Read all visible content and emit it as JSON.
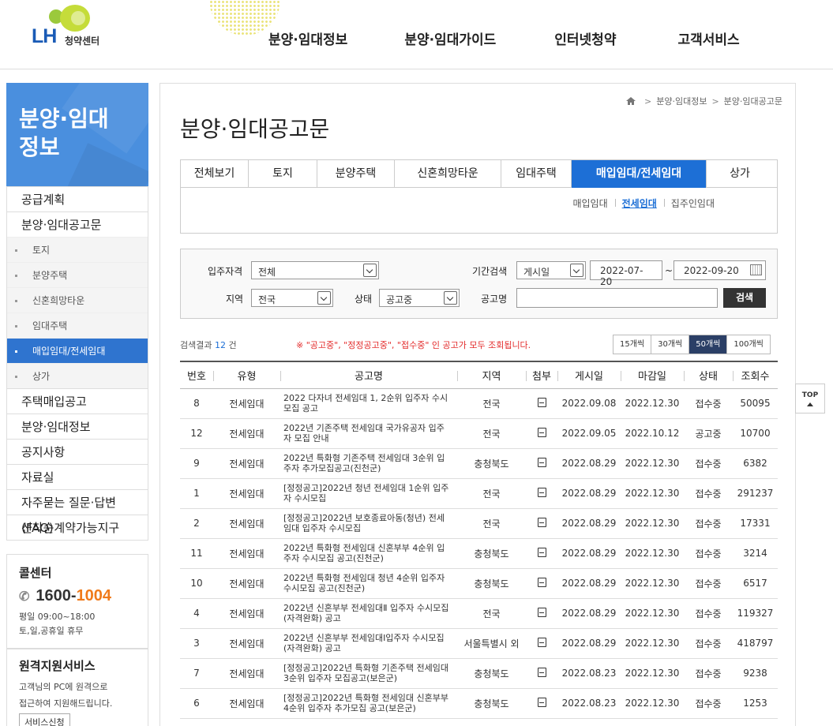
{
  "header": {
    "logo_text": "LH",
    "logo_sub": "청약센터",
    "nav": [
      "분양·임대정보",
      "분양·임대가이드",
      "인터넷청약",
      "고객서비스"
    ]
  },
  "sidebar": {
    "title": "분양·임대 정보",
    "menu": [
      {
        "label": "공급계획",
        "level": 1
      },
      {
        "label": "분양·임대공고문",
        "level": 1
      },
      {
        "label": "토지",
        "level": 2
      },
      {
        "label": "분양주택",
        "level": 2
      },
      {
        "label": "신혼희망타운",
        "level": 2
      },
      {
        "label": "임대주택",
        "level": 2
      },
      {
        "label": "매입임대/전세임대",
        "level": 2,
        "active": true
      },
      {
        "label": "상가",
        "level": 2
      },
      {
        "label": "주택매입공고",
        "level": 1
      },
      {
        "label": "분양·임대정보",
        "level": 1
      },
      {
        "label": "공지사항",
        "level": 1
      },
      {
        "label": "자료실",
        "level": 1
      },
      {
        "label": "자주묻는 질문·답변(FAQ)",
        "level": 1
      },
      {
        "label": "선착순계약가능지구",
        "level": 1
      }
    ],
    "callcenter": {
      "title": "콜센터",
      "num_a": "1600-",
      "num_b": "1004",
      "hours": "평일 09:00~18:00",
      "holiday": "토,일,공휴일 휴무"
    },
    "remote": {
      "title": "원격지원서비스",
      "line1": "고객님의 PC에 원격으로",
      "line2": "접근하여 지원해드립니다.",
      "button": "서비스신청"
    }
  },
  "breadcrumb": [
    "분양·임대정보",
    "분양·임대공고문"
  ],
  "page_title": "분양·임대공고문",
  "tabs": [
    "전체보기",
    "토지",
    "분양주택",
    "신혼희망타운",
    "임대주택",
    "매입임대/전세임대",
    "상가"
  ],
  "active_tab": "매입임대/전세임대",
  "subtabs": [
    "매입임대",
    "전세임대",
    "집주인임대"
  ],
  "active_subtab": "전세임대",
  "search": {
    "target_label": "입주자격",
    "target_value": "전체",
    "period_label": "기간검색",
    "period_type": "게시일",
    "date_from": "2022-07-20",
    "tilde": "~",
    "date_to": "2022-09-20",
    "region_label": "지역",
    "region_value": "전국",
    "status_label": "상태",
    "status_value": "공고중",
    "name_label": "공고명",
    "name_value": "",
    "button": "검색"
  },
  "result": {
    "prefix": "검색결과",
    "count": "12",
    "suffix": "건",
    "notice": "※ \"공고중\", \"정정공고중\", \"접수중\" 인 공고가 모두 조회됩니다."
  },
  "page_sizes": [
    "15개씩",
    "30개씩",
    "50개씩",
    "100개씩"
  ],
  "active_page_size": "50개씩",
  "table": {
    "headers": [
      "번호",
      "유형",
      "공고명",
      "지역",
      "첨부",
      "게시일",
      "마감일",
      "상태",
      "조회수"
    ],
    "rows": [
      {
        "no": "8",
        "type": "전세임대",
        "title": "2022 다자녀 전세임대 1, 2순위 입주자 수시모집 공고",
        "region": "전국",
        "posted": "2022.09.08",
        "deadline": "2022.12.30",
        "status": "접수중",
        "views": "50095"
      },
      {
        "no": "12",
        "type": "전세임대",
        "title": "2022년 기존주택 전세임대 국가유공자 입주자 모집 안내",
        "region": "전국",
        "posted": "2022.09.05",
        "deadline": "2022.10.12",
        "status": "공고중",
        "views": "10700"
      },
      {
        "no": "9",
        "type": "전세임대",
        "title": "2022년 특화형 기존주택 전세임대 3순위 입주자 추가모집공고(진천군)",
        "region": "충청북도",
        "posted": "2022.08.29",
        "deadline": "2022.12.30",
        "status": "접수중",
        "views": "6382"
      },
      {
        "no": "1",
        "type": "전세임대",
        "title": "[정정공고]2022년 청년 전세임대 1순위 입주자 수시모집",
        "region": "전국",
        "posted": "2022.08.29",
        "deadline": "2022.12.30",
        "status": "접수중",
        "views": "291237"
      },
      {
        "no": "2",
        "type": "전세임대",
        "title": "[정정공고]2022년 보호종료아동(청년) 전세임대 입주자 수시모집",
        "region": "전국",
        "posted": "2022.08.29",
        "deadline": "2022.12.30",
        "status": "접수중",
        "views": "17331"
      },
      {
        "no": "11",
        "type": "전세임대",
        "title": "2022년 특화형 전세임대 신혼부부 4순위 입주자 수시모집 공고(진천군)",
        "region": "충청북도",
        "posted": "2022.08.29",
        "deadline": "2022.12.30",
        "status": "접수중",
        "views": "3214"
      },
      {
        "no": "10",
        "type": "전세임대",
        "title": "2022년 특화형 전세임대 청년 4순위 입주자 수시모집 공고(진천군)",
        "region": "충청북도",
        "posted": "2022.08.29",
        "deadline": "2022.12.30",
        "status": "접수중",
        "views": "6517"
      },
      {
        "no": "4",
        "type": "전세임대",
        "title": "2022년 신혼부부 전세임대Ⅱ 입주자 수시모집(자격완화) 공고",
        "region": "전국",
        "posted": "2022.08.29",
        "deadline": "2022.12.30",
        "status": "접수중",
        "views": "119327"
      },
      {
        "no": "3",
        "type": "전세임대",
        "title": "2022년 신혼부부 전세임대Ⅰ입주자 수시모집(자격완화) 공고",
        "region": "서울특별시 외",
        "posted": "2022.08.29",
        "deadline": "2022.12.30",
        "status": "접수중",
        "views": "418797"
      },
      {
        "no": "7",
        "type": "전세임대",
        "title": "[정정공고]2022년 특화형 기존주택 전세임대 3순위 입주자 모집공고(보은군)",
        "region": "충청북도",
        "posted": "2022.08.23",
        "deadline": "2022.12.30",
        "status": "접수중",
        "views": "9238"
      },
      {
        "no": "6",
        "type": "전세임대",
        "title": "[정정공고]2022년 특화형 전세임대 신혼부부 4순위 입주자 추가모집 공고(보은군)",
        "region": "충청북도",
        "posted": "2022.08.23",
        "deadline": "2022.12.30",
        "status": "접수중",
        "views": "1253"
      }
    ]
  },
  "top_button": "TOP"
}
